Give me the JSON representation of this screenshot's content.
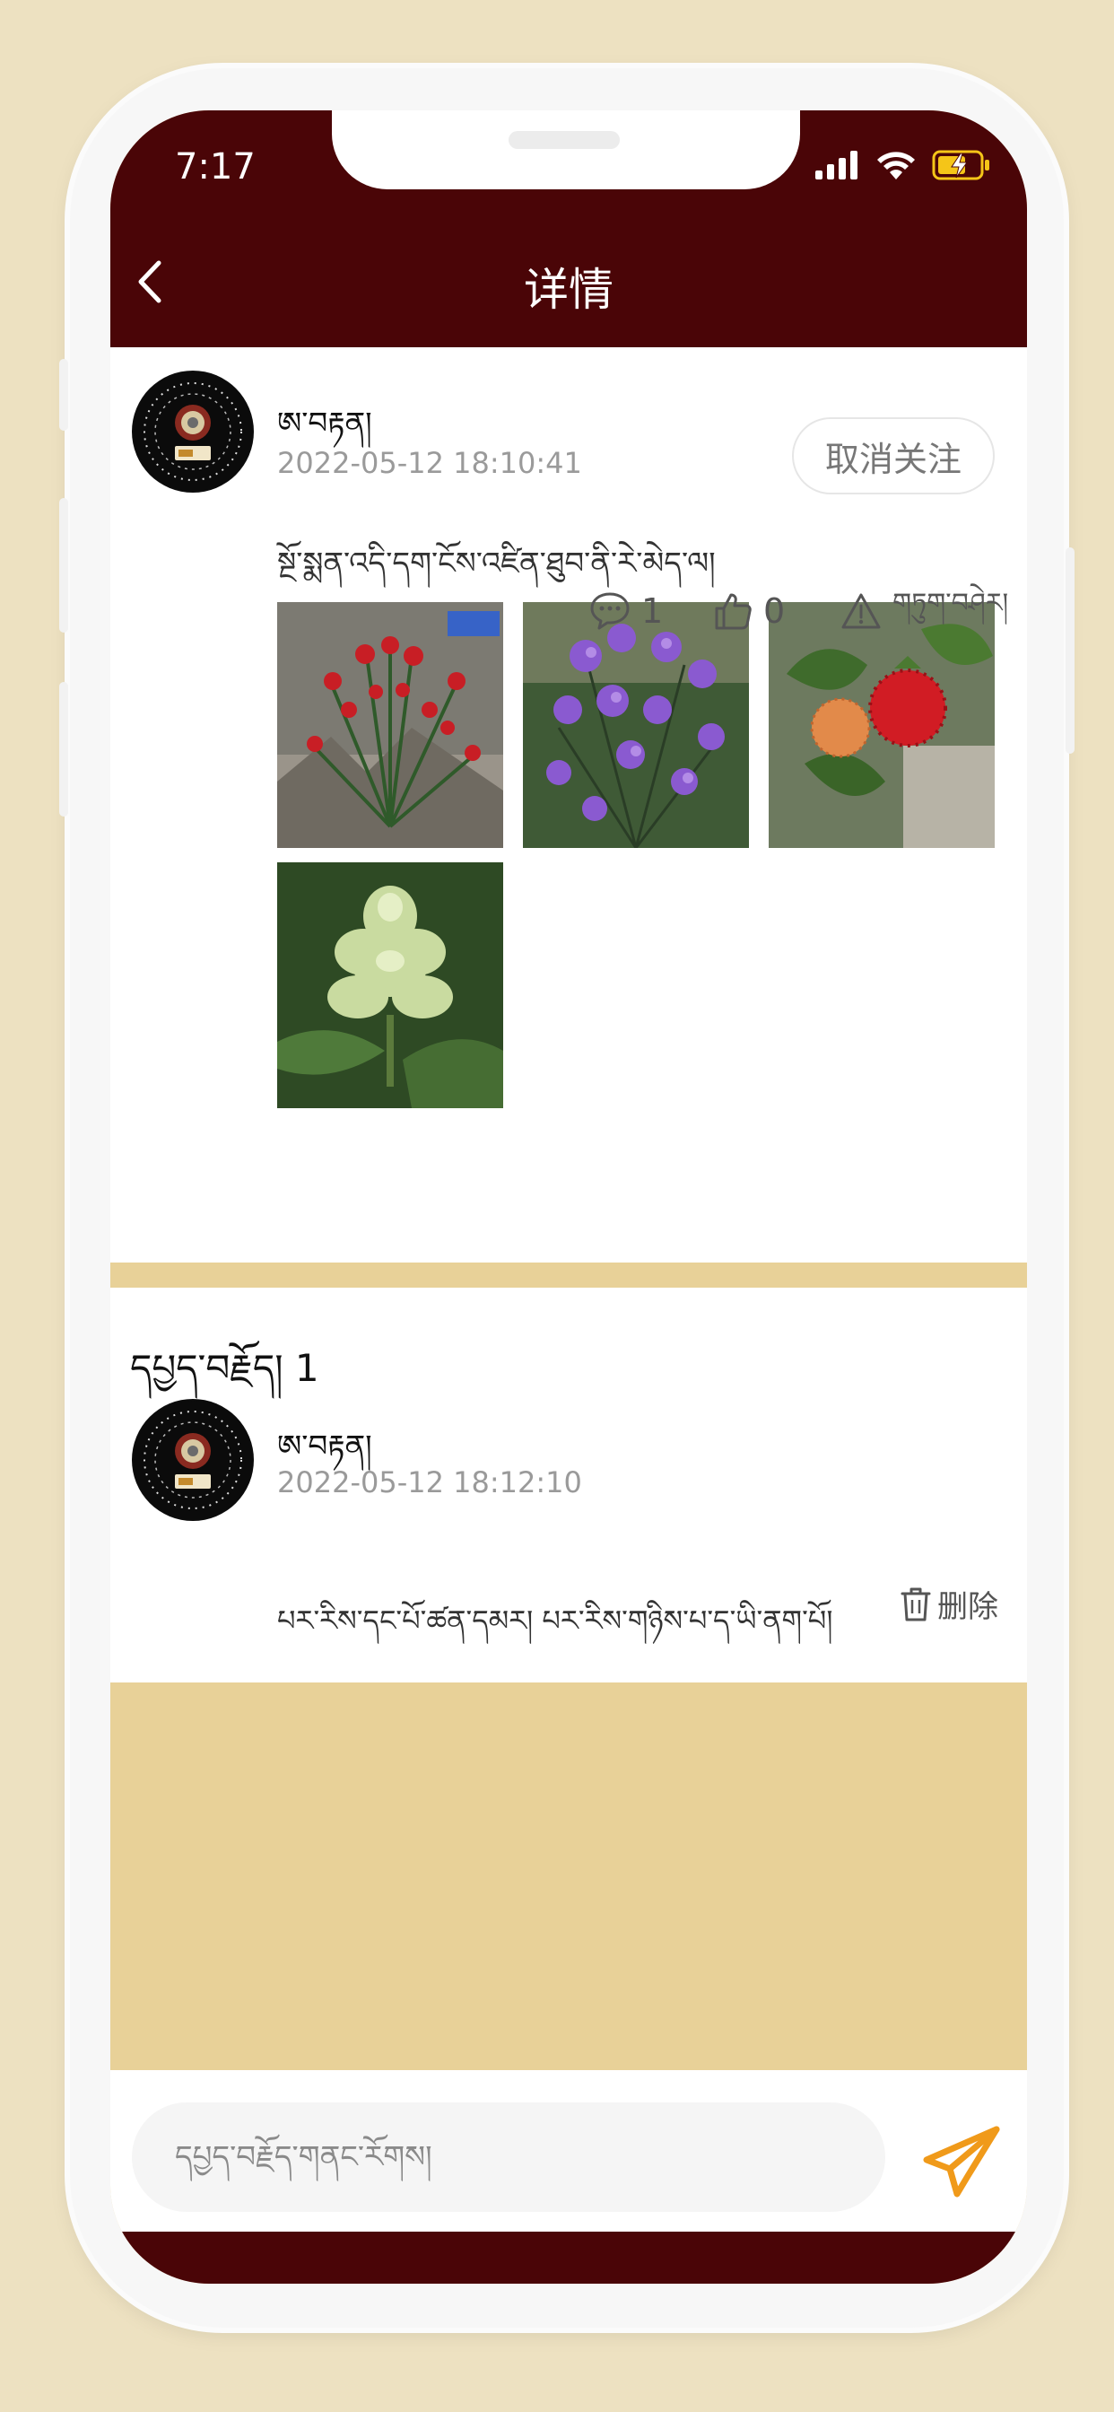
{
  "status_bar": {
    "time": "7:17"
  },
  "nav": {
    "title": "详情"
  },
  "post": {
    "author": "ཨ་བརྟན།",
    "timestamp": "2022-05-12 18:10:41",
    "follow_label": "取消关注",
    "text": "སྔོ་སྨན་འདི་དག་ངོས་འཛིན་ཐུབ་ནི་རེ་མེད་ལ།",
    "images": [
      "red-flower-plant",
      "purple-flowers",
      "red-berries",
      "pale-green-plant"
    ],
    "comment_count": "1",
    "like_count": "0",
    "report_label": "གཏུག་བཤེར།"
  },
  "comments_section": {
    "heading": "དཔྱད་བརྗོད།",
    "count": "1",
    "items": [
      {
        "author": "ཨ་བརྟན།",
        "timestamp": "2022-05-12 18:12:10",
        "text": "པར་རིས་དང་པོ་ཚན་དམར། པར་རིས་གཉིས་པ་ད་ཡི་ནག་པོ།",
        "delete_label": "删除"
      }
    ]
  },
  "comment_input": {
    "placeholder": "དཔྱད་བརྗོད་གནང་རོགས།"
  },
  "colors": {
    "header": "#4a0507",
    "background": "#e8d198",
    "send_accent": "#f09a1a"
  },
  "icons": [
    "back-arrow-icon",
    "signal-icon",
    "wifi-icon",
    "battery-charging-icon",
    "comment-icon",
    "thumbs-up-icon",
    "warning-icon",
    "trash-icon",
    "send-icon"
  ]
}
